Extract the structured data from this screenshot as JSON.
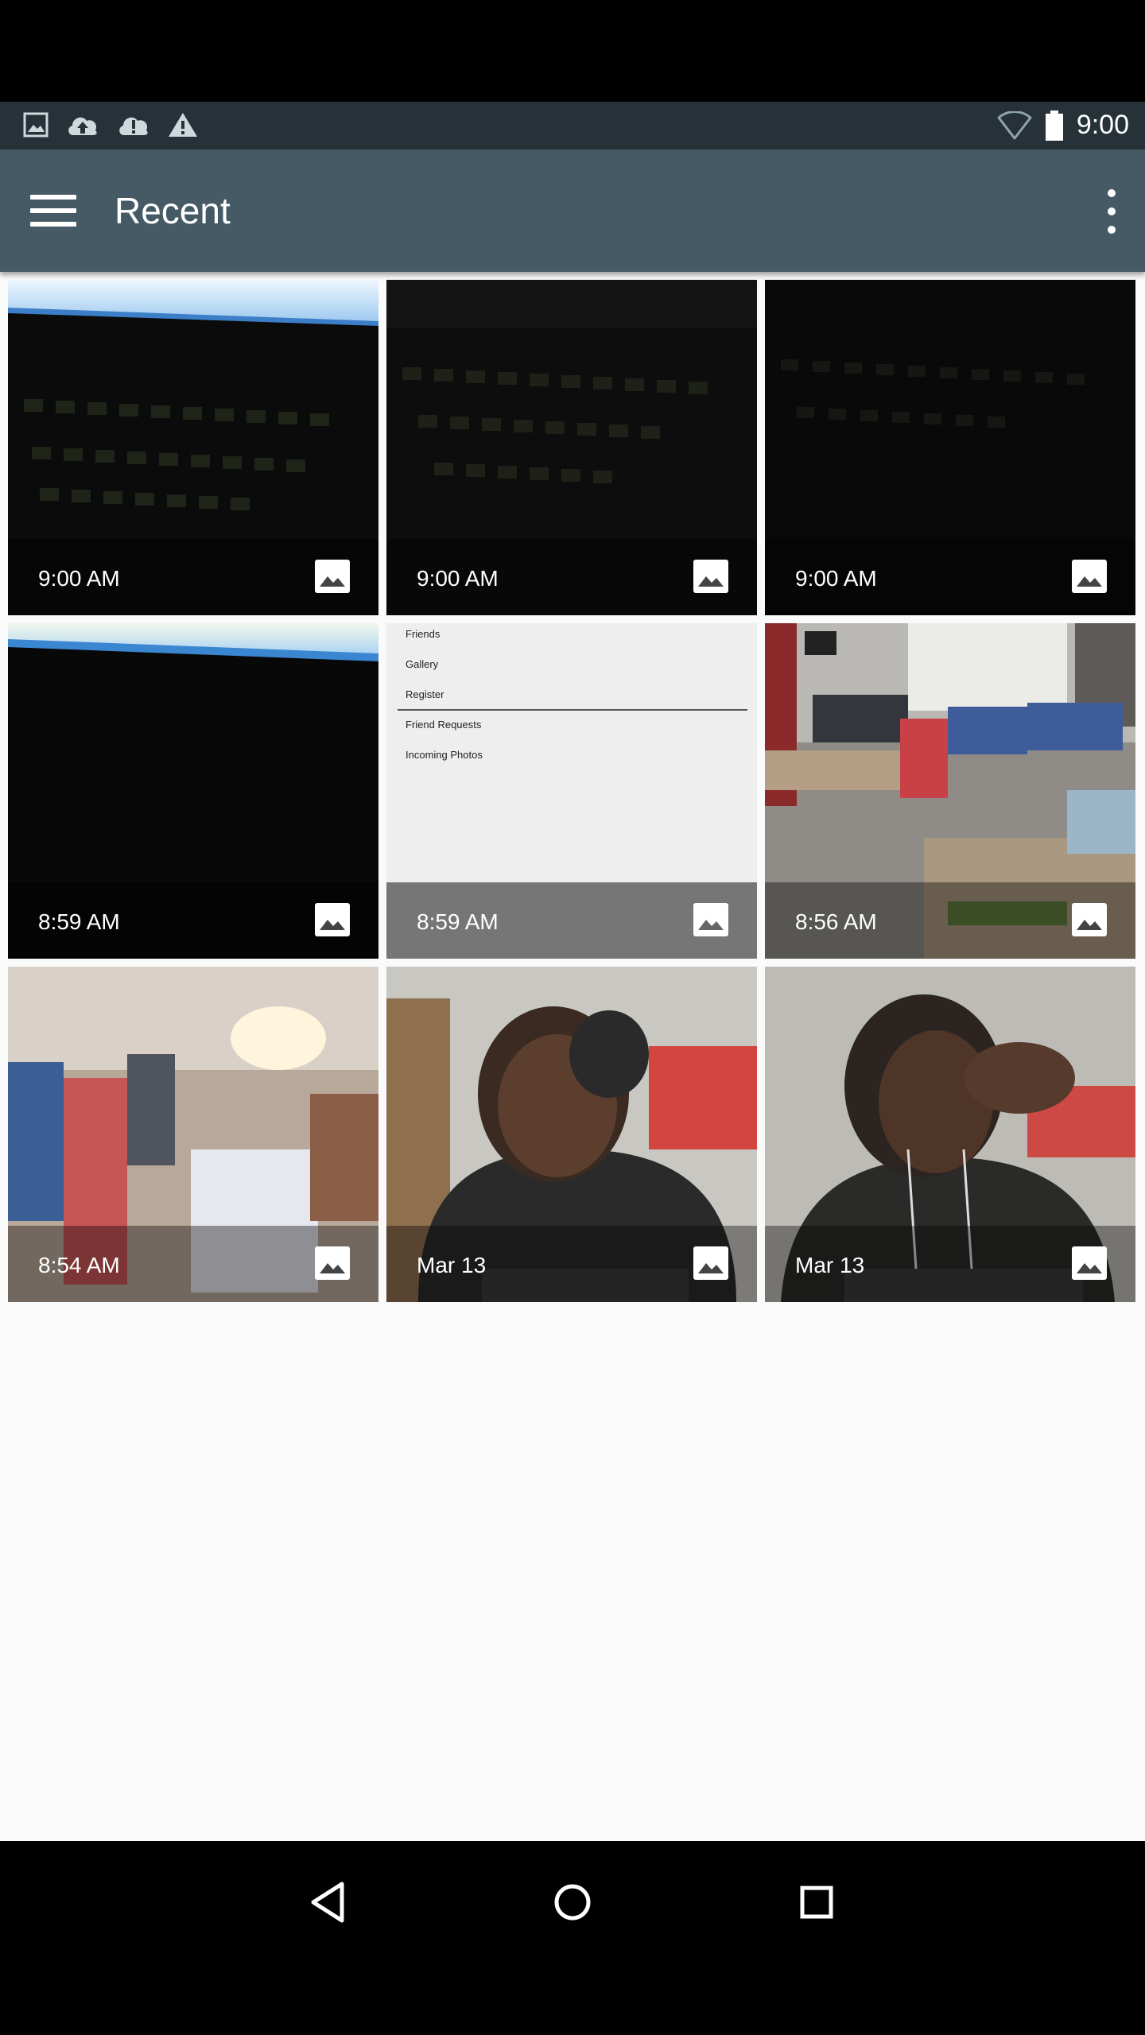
{
  "status_bar": {
    "left_icons": [
      "image-notification-icon",
      "cloud-upload-icon",
      "cloud-alert-icon",
      "warning-icon"
    ],
    "right_icons": [
      "wifi-icon",
      "battery-icon"
    ],
    "time": "9:00"
  },
  "app_bar": {
    "title": "Recent",
    "menu_icon": "hamburger-menu-icon",
    "overflow_icon": "more-vert-icon"
  },
  "grid": {
    "items": [
      {
        "label": "9:00 AM",
        "type_icon": "image-icon",
        "thumb": "keyboard-with-screen"
      },
      {
        "label": "9:00 AM",
        "type_icon": "image-icon",
        "thumb": "dark-keyboard"
      },
      {
        "label": "9:00 AM",
        "type_icon": "image-icon",
        "thumb": "dark-keyboard-dim"
      },
      {
        "label": "8:59 AM",
        "type_icon": "image-icon",
        "thumb": "dark-with-screen"
      },
      {
        "label": "8:59 AM",
        "type_icon": "image-icon",
        "thumb": "menu-screenshot"
      },
      {
        "label": "8:56 AM",
        "type_icon": "image-icon",
        "thumb": "classroom"
      },
      {
        "label": "8:54 AM",
        "type_icon": "image-icon",
        "thumb": "blurry-room"
      },
      {
        "label": "Mar 13",
        "type_icon": "image-icon",
        "thumb": "portrait-1"
      },
      {
        "label": "Mar 13",
        "type_icon": "image-icon",
        "thumb": "portrait-2"
      }
    ],
    "screenshot_menu": [
      "Friends",
      "Gallery",
      "Register",
      "Friend Requests",
      "Incoming Photos"
    ]
  },
  "nav_bar": {
    "buttons": [
      "back-icon",
      "home-icon",
      "recents-icon"
    ]
  }
}
